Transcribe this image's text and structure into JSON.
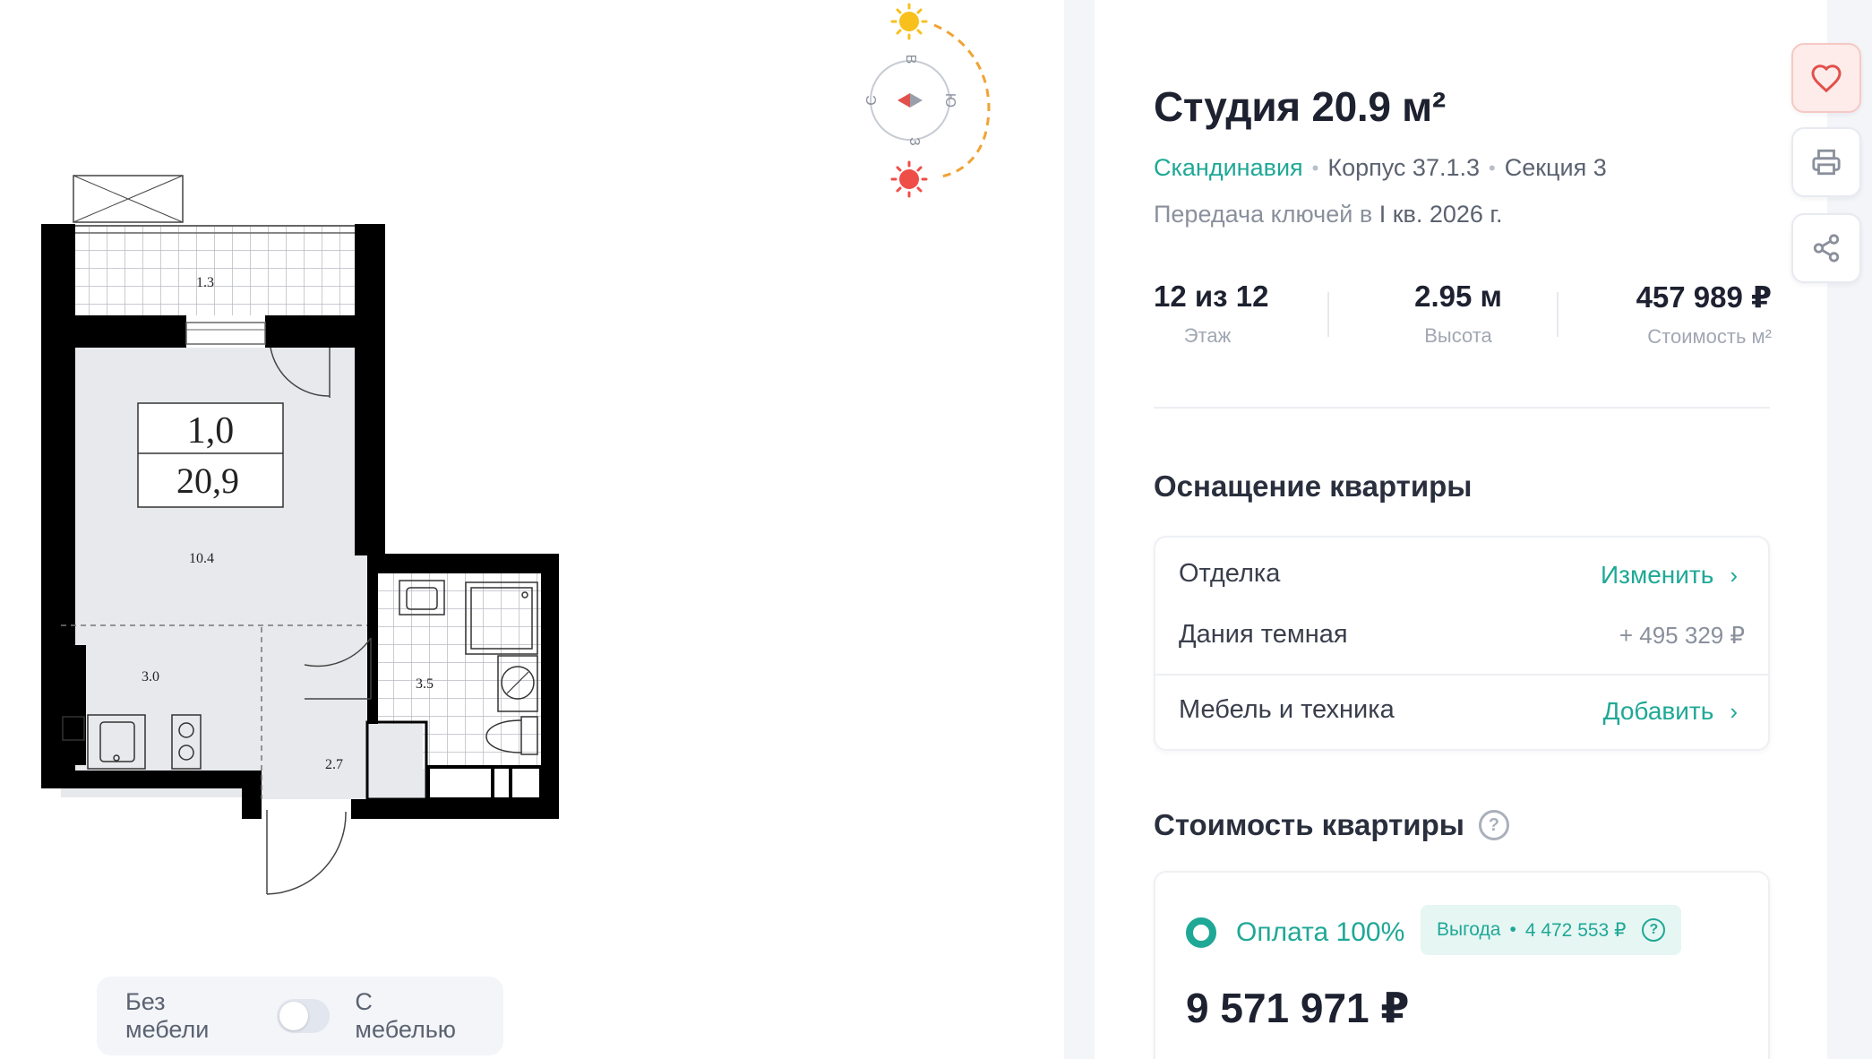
{
  "plan": {
    "rooms": {
      "balcony": "1.3",
      "living": "10.4",
      "kitchen": "3.0",
      "bathroom": "3.5",
      "hall": "2.7"
    },
    "summary_top": "1,0",
    "summary_bottom": "20,9",
    "compass": {
      "north": "С",
      "east": "В",
      "south": "Ю",
      "west": "З"
    }
  },
  "furniture_toggle": {
    "off_label": "Без мебели",
    "on_label": "С мебелью",
    "enabled": false
  },
  "apartment": {
    "title": "Студия 20.9 м²",
    "complex": "Скандинавия",
    "building": "Корпус 37.1.3",
    "section": "Секция 3",
    "handover_prefix": "Передача ключей в",
    "handover_value": "I кв. 2026 г."
  },
  "stats": [
    {
      "value": "12 из 12",
      "label": "Этаж"
    },
    {
      "value": "2.95 м",
      "label": "Высота"
    },
    {
      "value": "457 989 ₽",
      "label": "Стоимость м²"
    }
  ],
  "equipment": {
    "title": "Оснащение квартиры",
    "finish_label": "Отделка",
    "finish_action": "Изменить",
    "finish_option": "Дания темная",
    "finish_price": "+ 495 329 ₽",
    "furniture_label": "Мебель и техника",
    "furniture_action": "Добавить"
  },
  "pricing": {
    "title": "Стоимость квартиры",
    "option_label": "Оплата 100%",
    "benefit_label": "Выгода",
    "benefit_value": "4 472 553 ₽",
    "total": "9 571 971 ₽"
  },
  "colors": {
    "accent": "#1fa896",
    "favorite": "#e2504b",
    "sun_morning": "#f7c01d",
    "sun_evening": "#ef4d48"
  },
  "icons": {
    "favorite": "heart-icon",
    "print": "printer-icon",
    "share": "share-icon"
  }
}
